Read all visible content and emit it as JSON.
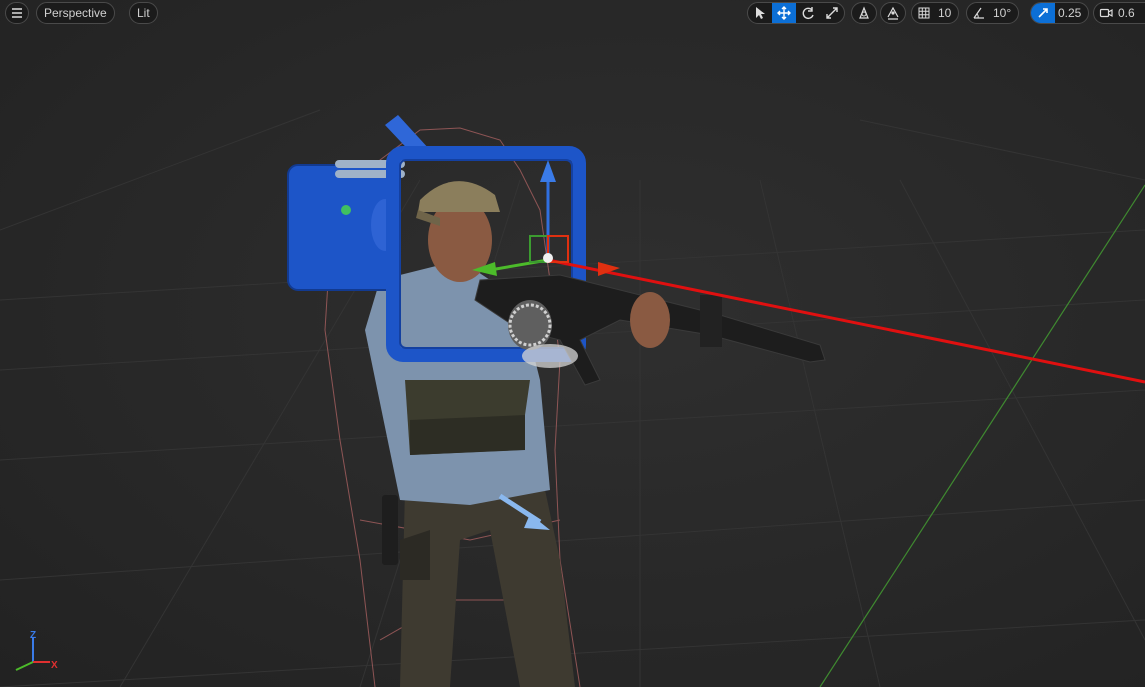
{
  "toolbar": {
    "menu_icon": "hamburger-icon",
    "view_mode": "Perspective",
    "lighting_mode": "Lit",
    "transform_tools": [
      {
        "name": "select-tool",
        "icon": "cursor-icon",
        "active": false
      },
      {
        "name": "translate-tool",
        "icon": "move-icon",
        "active": true
      },
      {
        "name": "rotate-tool",
        "icon": "rotate-icon",
        "active": false
      },
      {
        "name": "scale-tool",
        "icon": "scale-icon",
        "active": false
      }
    ],
    "grid_snap_value": "10",
    "rotation_snap_value": "10°",
    "scale_snap_value": "0.25",
    "camera_speed_value": "0.6"
  },
  "axis_indicator": {
    "z_label": "Z",
    "x_label": "X",
    "colors": {
      "z": "#3a7be8",
      "x": "#e03030",
      "y": "#4cbb2a"
    }
  },
  "colors": {
    "accent": "#0c6fd6",
    "gizmo_x": "#e01010",
    "gizmo_y": "#4cbb2a",
    "gizmo_z": "#2f6fe0",
    "camera_body": "#1d55c8"
  }
}
